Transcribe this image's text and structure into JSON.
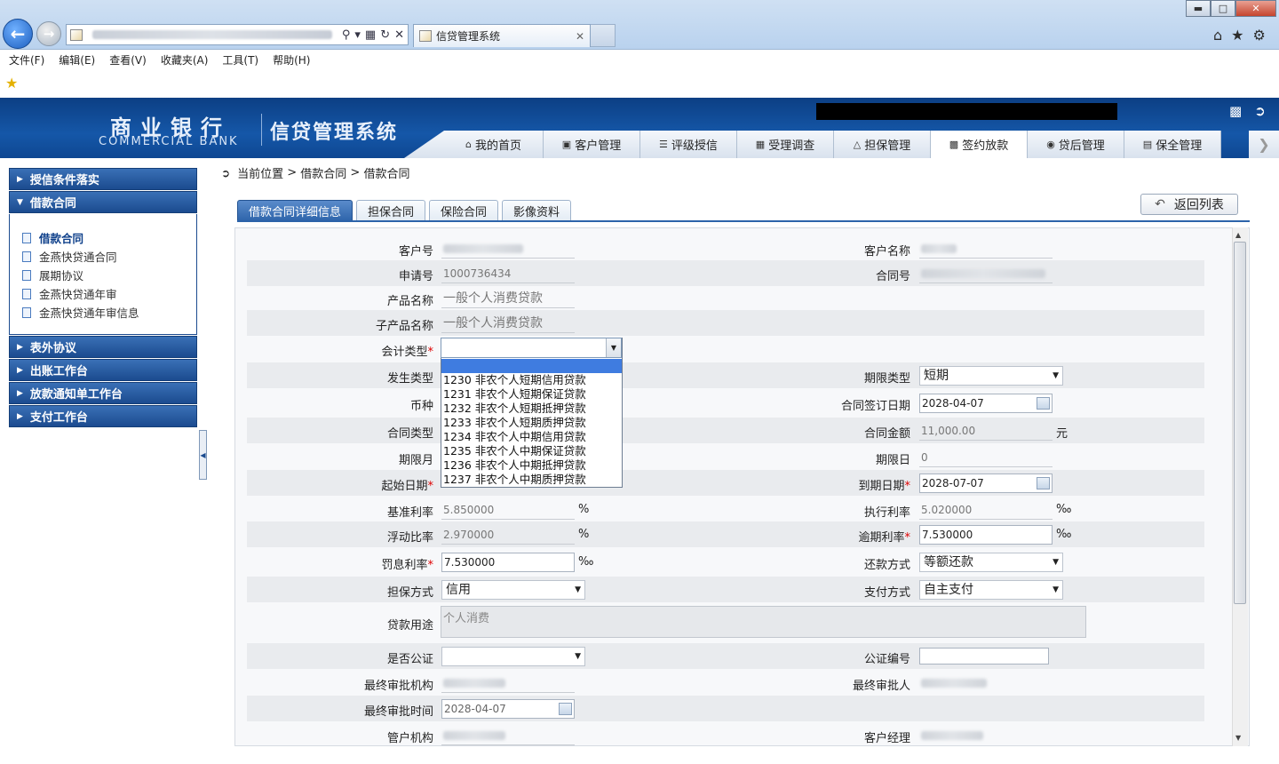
{
  "browser": {
    "tab_title": "信贷管理系统",
    "menu": [
      "文件(F)",
      "编辑(E)",
      "查看(V)",
      "收藏夹(A)",
      "工具(T)",
      "帮助(H)"
    ]
  },
  "header": {
    "bank_cn": "商业银行",
    "bank_en": "COMMERCIAL BANK",
    "system_title": "信贷管理系统",
    "tabs": [
      "我的首页",
      "客户管理",
      "评级授信",
      "受理调查",
      "担保管理",
      "签约放款",
      "贷后管理",
      "保全管理"
    ],
    "active_tab": "签约放款"
  },
  "sidebar": {
    "groups": [
      {
        "label": "授信条件落实"
      },
      {
        "label": "借款合同",
        "items": [
          "借款合同",
          "金燕快贷通合同",
          "展期协议",
          "金燕快贷通年审",
          "金燕快贷通年审信息"
        ]
      },
      {
        "label": "表外协议"
      },
      {
        "label": "出账工作台"
      },
      {
        "label": "放款通知单工作台"
      },
      {
        "label": "支付工作台"
      }
    ]
  },
  "breadcrumb": {
    "prefix": "当前位置",
    "sep": ">",
    "level1": "借款合同",
    "level2": "借款合同"
  },
  "content_tabs": [
    "借款合同详细信息",
    "担保合同",
    "保险合同",
    "影像资料"
  ],
  "back_button": "返回列表",
  "form": {
    "customer_no_label": "客户号",
    "customer_name_label": "客户名称",
    "application_no_label": "申请号",
    "application_no": "1000736434",
    "contract_no_label": "合同号",
    "product_label": "产品名称",
    "product": "一般个人消费贷款",
    "sub_product_label": "子产品名称",
    "sub_product": "一般个人消费贷款",
    "accounting_type_label": "会计类型",
    "occurrence_type_label": "发生类型",
    "term_type_label": "期限类型",
    "term_type": "短期",
    "currency_label": "币种",
    "sign_date_label": "合同签订日期",
    "sign_date": "2028-04-07",
    "contract_type_label": "合同类型",
    "contract_amount_label": "合同金额",
    "contract_amount": "11,000.00",
    "amount_unit": "元",
    "term_month_label": "期限月",
    "term_day_label": "期限日",
    "term_day": "0",
    "start_date_label": "起始日期",
    "end_date_label": "到期日期",
    "end_date": "2028-07-07",
    "base_rate_label": "基准利率",
    "base_rate": "5.850000",
    "pct": "%",
    "permille": "‰",
    "exec_rate_label": "执行利率",
    "exec_rate": "5.020000",
    "float_ratio_label": "浮动比率",
    "float_ratio": "2.970000",
    "overdue_rate_label": "逾期利率",
    "overdue_rate": "7.530000",
    "penalty_rate_label": "罚息利率",
    "penalty_rate": "7.530000",
    "repay_method_label": "还款方式",
    "repay_method": "等额还款",
    "guarantee_label": "担保方式",
    "guarantee": "信用",
    "payment_label": "支付方式",
    "payment": "自主支付",
    "purpose_label": "贷款用途",
    "purpose": "个人消费",
    "notarized_label": "是否公证",
    "notary_no_label": "公证编号",
    "final_org_label": "最终审批机构",
    "final_approver_label": "最终审批人",
    "final_time_label": "最终审批时间",
    "final_time": "2028-04-07",
    "mgmt_org_label": "管户机构",
    "manager_label": "客户经理"
  },
  "dropdown_options": [
    "1230 非农个人短期信用贷款",
    "1231 非农个人短期保证贷款",
    "1232 非农个人短期抵押贷款",
    "1233 非农个人短期质押贷款",
    "1234 非农个人中期信用贷款",
    "1235 非农个人中期保证贷款",
    "1236 非农个人中期抵押贷款",
    "1237 非农个人中期质押贷款"
  ]
}
